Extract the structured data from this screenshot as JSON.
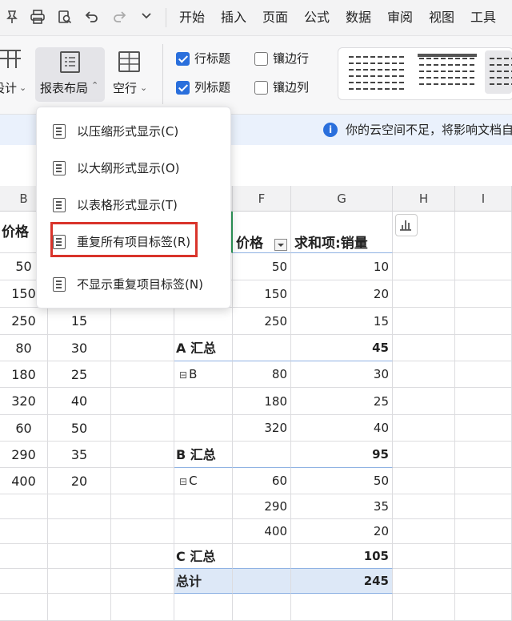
{
  "toolbar": {
    "icons": [
      "pin-icon",
      "print-icon",
      "print-preview-icon",
      "undo-icon",
      "redo-icon",
      "chevron-down-icon"
    ],
    "menus": [
      "开始",
      "插入",
      "页面",
      "公式",
      "数据",
      "审阅",
      "视图",
      "工具"
    ]
  },
  "ribbon": {
    "design_label": "设计",
    "report_layout_label": "报表布局",
    "blank_rows_label": "空行",
    "row_headers": "行标题",
    "banded_rows": "镶边行",
    "col_headers": "列标题",
    "banded_cols": "镶边列",
    "row_headers_checked": true,
    "col_headers_checked": true,
    "banded_rows_checked": false,
    "banded_cols_checked": false
  },
  "notice": {
    "text": "你的云空间不足，将影响文档自"
  },
  "dropdown": {
    "items": [
      "以压缩形式显示(C)",
      "以大纲形式显示(O)",
      "以表格形式显示(T)",
      "重复所有项目标签(R)",
      "不显示重复项目标签(N)"
    ],
    "highlighted_index": 3
  },
  "sheet": {
    "columns": [
      "B",
      "F",
      "G",
      "H",
      "I"
    ],
    "left_table": {
      "header": "价格",
      "rows": [
        [
          "50",
          ""
        ],
        [
          "150",
          ""
        ],
        [
          "250",
          "15"
        ],
        [
          "80",
          "30"
        ],
        [
          "180",
          "25"
        ],
        [
          "320",
          "40"
        ],
        [
          "60",
          "50"
        ],
        [
          "290",
          "35"
        ],
        [
          "400",
          "20"
        ]
      ]
    },
    "pivot": {
      "header_price": "价格",
      "header_sum": "求和项:销量",
      "rows": [
        {
          "label": "",
          "price": "50",
          "qty": "10"
        },
        {
          "label": "",
          "price": "150",
          "qty": "20"
        },
        {
          "label": "",
          "price": "250",
          "qty": "15"
        },
        {
          "label": "A 汇总",
          "price": "",
          "qty": "45",
          "subtotal": true
        },
        {
          "label": "B",
          "price": "80",
          "qty": "30",
          "toggle": "⊟"
        },
        {
          "label": "",
          "price": "180",
          "qty": "25"
        },
        {
          "label": "",
          "price": "320",
          "qty": "40"
        },
        {
          "label": "B 汇总",
          "price": "",
          "qty": "95",
          "subtotal": true
        },
        {
          "label": "C",
          "price": "60",
          "qty": "50",
          "toggle": "⊟"
        },
        {
          "label": "",
          "price": "290",
          "qty": "35"
        },
        {
          "label": "",
          "price": "400",
          "qty": "20"
        },
        {
          "label": "C 汇总",
          "price": "",
          "qty": "105",
          "subtotal": true
        },
        {
          "label": "总计",
          "price": "",
          "qty": "245",
          "total": true
        }
      ]
    }
  },
  "colors": {
    "accent": "#2a6fdc",
    "highlight_border": "#d9342b",
    "total_row_bg": "#dde8f7"
  }
}
